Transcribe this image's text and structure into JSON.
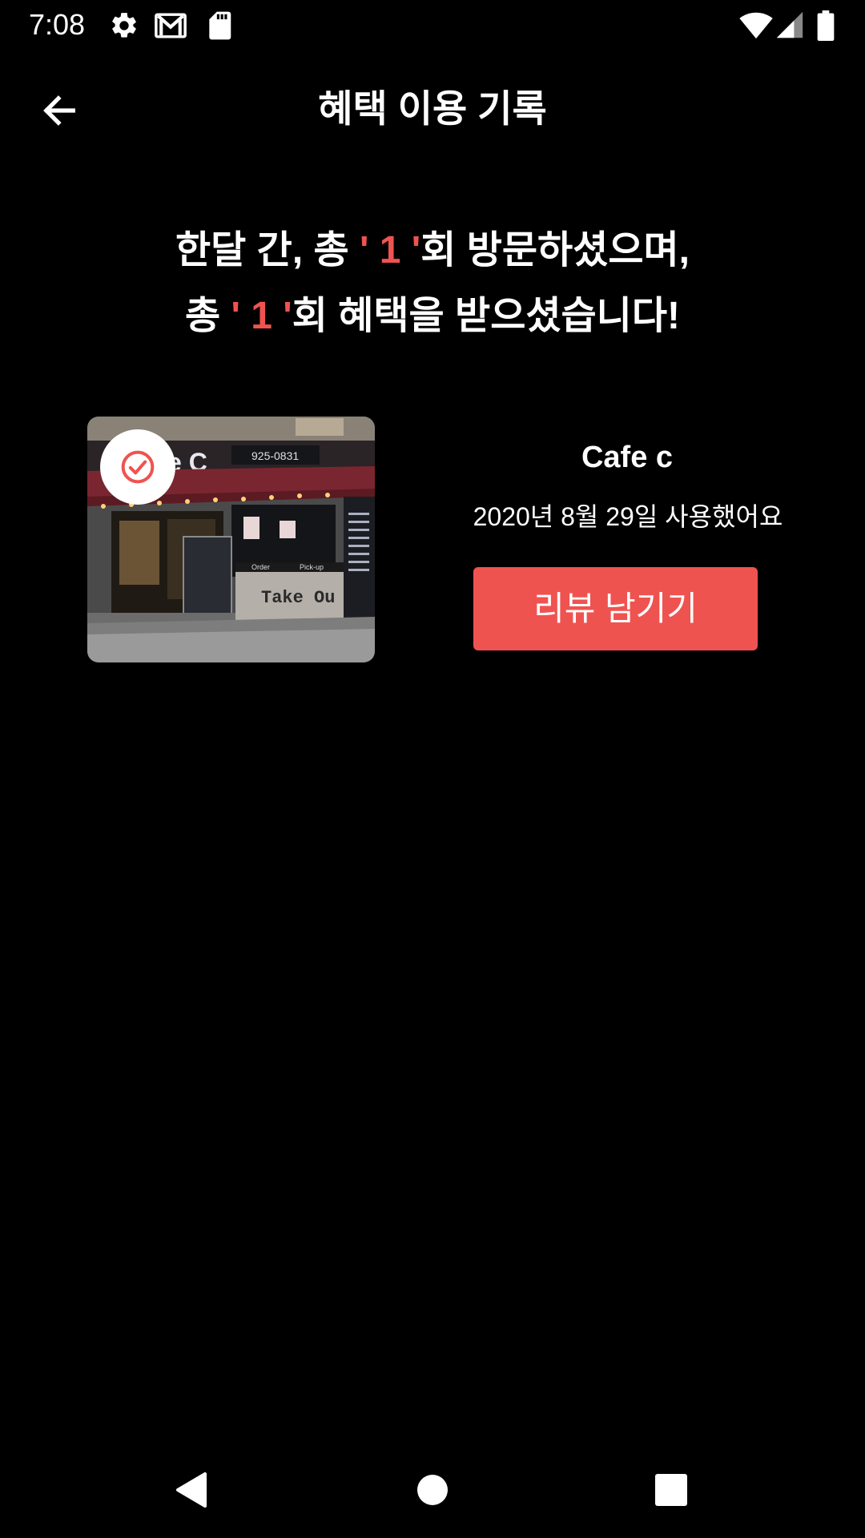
{
  "status_bar": {
    "time": "7:08",
    "left_icons": [
      "gear-icon",
      "gmail-icon",
      "sd-card-icon"
    ],
    "right_icons": [
      "wifi-icon",
      "cell-signal-icon",
      "battery-icon"
    ]
  },
  "toolbar": {
    "back_icon": "arrow-left-icon",
    "title": "혜택 이용 기록"
  },
  "summary": {
    "line1_prefix": "한달 간, 총",
    "visit_count": "' 1 '",
    "line1_suffix": "회 방문하셨으며,",
    "line2_prefix": "총",
    "benefit_count": "' 1 '",
    "line2_suffix": "회 혜택을 받으셨습니다!"
  },
  "records": [
    {
      "cafe_name": "Cafe c",
      "usage_date": "2020년 8월 29일 사용했어요",
      "review_button_label": "리뷰 남기기",
      "photo_sign_text": "e C",
      "photo_phone": "925-0831",
      "photo_takeout": "Take Ou",
      "photo_order": "Order",
      "photo_pickup": "Pick-up"
    }
  ],
  "nav_bar": {
    "buttons": [
      "back-triangle-icon",
      "home-circle-icon",
      "recents-square-icon"
    ]
  },
  "colors": {
    "accent": "#ef5350",
    "background": "#000000",
    "text": "#ffffff"
  }
}
